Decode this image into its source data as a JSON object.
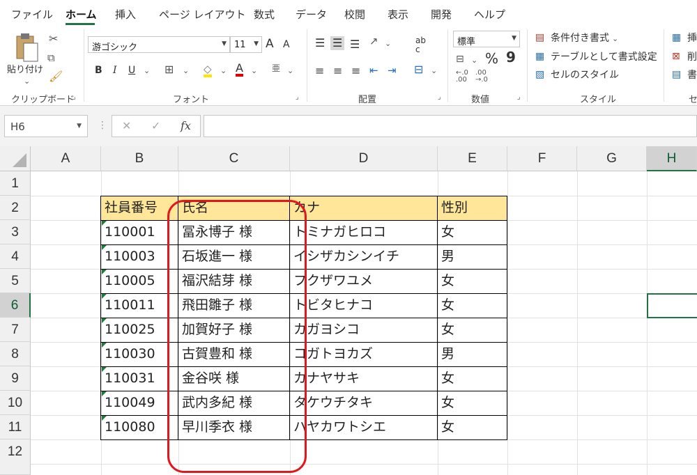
{
  "menu": {
    "tabs": [
      "ファイル",
      "ホーム",
      "挿入",
      "ページ レイアウト",
      "数式",
      "データ",
      "校閲",
      "表示",
      "開発",
      "ヘルプ"
    ],
    "active": "ホーム"
  },
  "ribbon": {
    "clipboard": {
      "paste_label": "貼り付け",
      "group_label": "クリップボード"
    },
    "font": {
      "font_name": "游ゴシック",
      "font_size": "11",
      "grow": "A",
      "shrink": "A",
      "bold": "B",
      "italic": "I",
      "underline": "U",
      "phonetic": "亜",
      "group_label": "フォント"
    },
    "alignment": {
      "wrap": "ab\nc",
      "group_label": "配置"
    },
    "number": {
      "format": "標準",
      "percent": "%",
      "comma": "9",
      "group_label": "数値"
    },
    "styles": {
      "conditional": "条件付き書式",
      "table": "テーブルとして書式設定",
      "cell_styles": "セルのスタイル",
      "group_label": "スタイル"
    },
    "cells": {
      "insert": "挿",
      "delete": "削",
      "format": "書",
      "group_label": "セ"
    }
  },
  "formula_bar": {
    "name_box": "H6",
    "fx": "fx",
    "cancel": "✕",
    "enter": "✓",
    "value": ""
  },
  "sheet": {
    "columns": [
      "A",
      "B",
      "C",
      "D",
      "E",
      "F",
      "G",
      "H"
    ],
    "selected_column": "H",
    "rows": [
      "1",
      "2",
      "3",
      "4",
      "5",
      "6",
      "7",
      "8",
      "9",
      "10",
      "11",
      "12"
    ],
    "selected_row": "6",
    "table_header": [
      "社員番号",
      "氏名",
      "カナ",
      "性別"
    ],
    "table_rows": [
      [
        "110001",
        "冨永博子 様",
        "トミナガヒロコ",
        "女"
      ],
      [
        "110003",
        "石坂進一 様",
        "イシザカシンイチ",
        "男"
      ],
      [
        "110005",
        "福沢結芽 様",
        "フクザワユメ",
        "女"
      ],
      [
        "110011",
        "飛田雛子 様",
        "トビタヒナコ",
        "女"
      ],
      [
        "110025",
        "加賀好子 様",
        "カガヨシコ",
        "女"
      ],
      [
        "110030",
        "古賀豊和 様",
        "コガトヨカズ",
        "男"
      ],
      [
        "110031",
        "金谷咲 様",
        "カナヤサキ",
        "女"
      ],
      [
        "110049",
        "武内多紀 様",
        "タケウチタキ",
        "女"
      ],
      [
        "110080",
        "早川季衣 様",
        "ハヤカワトシエ",
        "女"
      ]
    ]
  },
  "colors": {
    "accent": "#217346",
    "header_fill": "#ffe699",
    "annotation": "#e3161d"
  }
}
